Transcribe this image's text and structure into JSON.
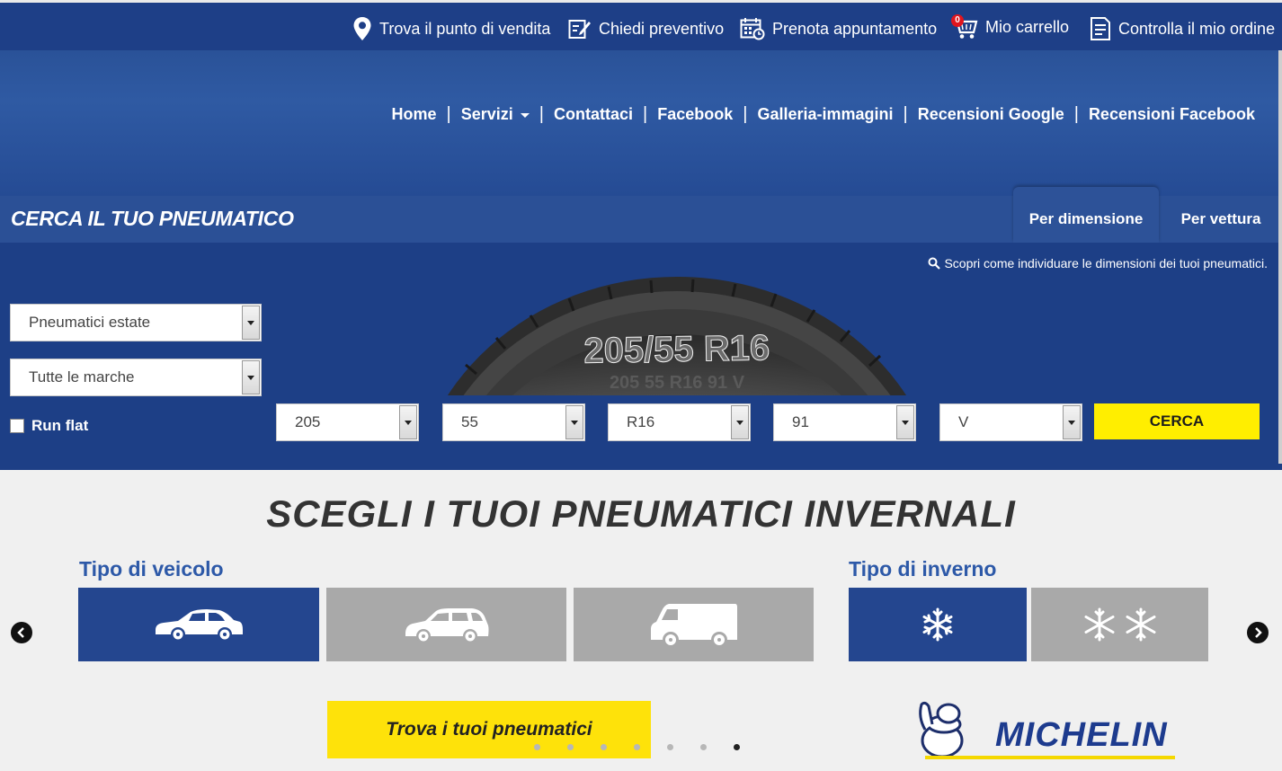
{
  "topbar": {
    "items": [
      {
        "label": "Trova il punto di vendita",
        "icon": "location-pin-icon"
      },
      {
        "label": "Chiedi preventivo",
        "icon": "edit-form-icon"
      },
      {
        "label": "Prenota appuntamento",
        "icon": "calendar-clock-icon"
      },
      {
        "label": "Mio carrello",
        "icon": "shopping-cart-icon",
        "badge": "0"
      },
      {
        "label": "Controlla il mio ordine",
        "icon": "order-list-icon"
      }
    ]
  },
  "nav": {
    "items": [
      "Home",
      "Servizi",
      "Contattaci",
      "Facebook",
      "Galleria-immagini",
      "Recensioni Google",
      "Recensioni Facebook"
    ]
  },
  "search": {
    "title": "CERCA IL TUO PNEUMATICO",
    "tabs": [
      "Per dimensione",
      "Per vettura"
    ],
    "active_tab": "Per dimensione",
    "help_link": "Scopri come individuare le dimensioni dei tuoi pneumatici.",
    "season_select": "Pneumatici estate",
    "brand_select": "Tutte le marche",
    "run_flat_label": "Run flat",
    "run_flat_checked": false,
    "width": "205",
    "ratio": "55",
    "rim": "R16",
    "load_index": "91",
    "speed_index": "V",
    "button": "CERCA",
    "tyre_main_text": "205/55 R16",
    "tyre_sub_text": "205 55 R16 91 V"
  },
  "winter": {
    "title": "SCEGLI I TUOI PNEUMATICI INVERNALI",
    "vehicle_label": "Tipo di veicolo",
    "winter_label": "Tipo di inverno",
    "vehicle_tiles": [
      {
        "icon": "sedan-car-icon",
        "active": true
      },
      {
        "icon": "suv-car-icon",
        "active": false
      },
      {
        "icon": "van-icon",
        "active": false
      }
    ],
    "winter_tiles": [
      {
        "icon": "snowflake-icon",
        "active": true
      },
      {
        "icon": "double-snowflake-icon",
        "active": false
      }
    ],
    "cta": "Trova i tuoi pneumatici",
    "brand_logo": "MICHELIN",
    "dots_total": 7,
    "dot_active_index": 6
  },
  "colors": {
    "topbar": "#1e3f87",
    "panel": "#1d3f86",
    "accent_yellow": "#ffee00",
    "title_blue": "#2d59a8",
    "tile_inactive": "#a9a9a9"
  }
}
